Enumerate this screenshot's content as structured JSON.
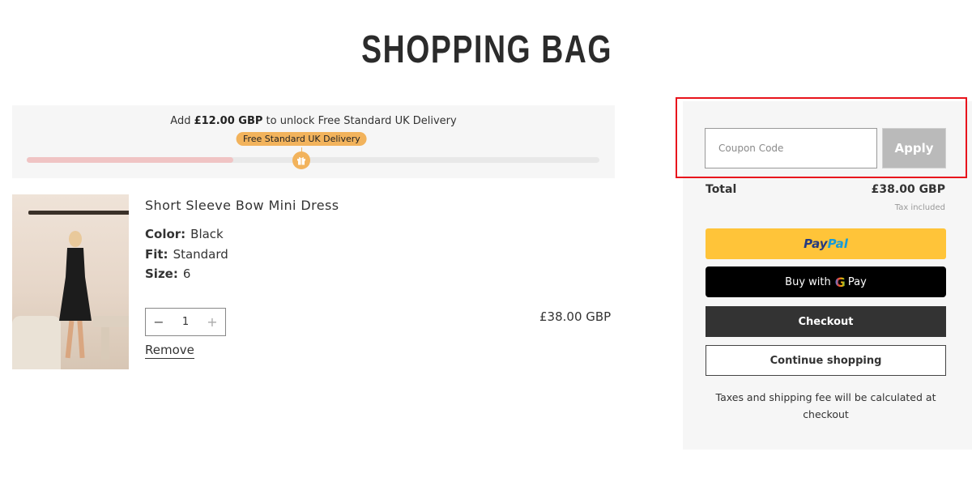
{
  "page": {
    "title": "SHOPPING BAG"
  },
  "shipping_banner": {
    "prefix": "Add ",
    "amount": "£12.00 GBP",
    "suffix": " to unlock Free Standard UK Delivery",
    "milestone_label": "Free Standard UK Delivery",
    "milestone_icon": "gift-icon",
    "progress_fraction": 0.36,
    "milestone_fraction": 0.48,
    "colors": {
      "fill": "#f0c4c4",
      "milestone": "#f2b35c"
    }
  },
  "cart": {
    "items": [
      {
        "title": "Short Sleeve Bow Mini Dress",
        "attributes": [
          {
            "label": "Color:",
            "value": "Black"
          },
          {
            "label": "Fit:",
            "value": "Standard"
          },
          {
            "label": "Size:",
            "value": "6"
          }
        ],
        "quantity": "1",
        "decrement_symbol": "−",
        "increment_symbol": "+",
        "remove_label": "Remove",
        "price": "£38.00 GBP"
      }
    ]
  },
  "summary": {
    "coupon_placeholder": "Coupon Code",
    "coupon_value": "",
    "apply_label": "Apply",
    "total_label": "Total",
    "total_value": "£38.00 GBP",
    "tax_note": "Tax included",
    "paypal": {
      "part1": "Pay",
      "part2": "Pal"
    },
    "gpay": {
      "prefix": "Buy with",
      "g": "G",
      "suffix": "Pay"
    },
    "checkout_label": "Checkout",
    "continue_label": "Continue shopping",
    "footnote": "Taxes and shipping fee will be calculated at checkout",
    "colors": {
      "paypal": "#ffc439",
      "gpay": "#000000",
      "checkout": "#333333",
      "highlight": "#e8141c"
    }
  }
}
